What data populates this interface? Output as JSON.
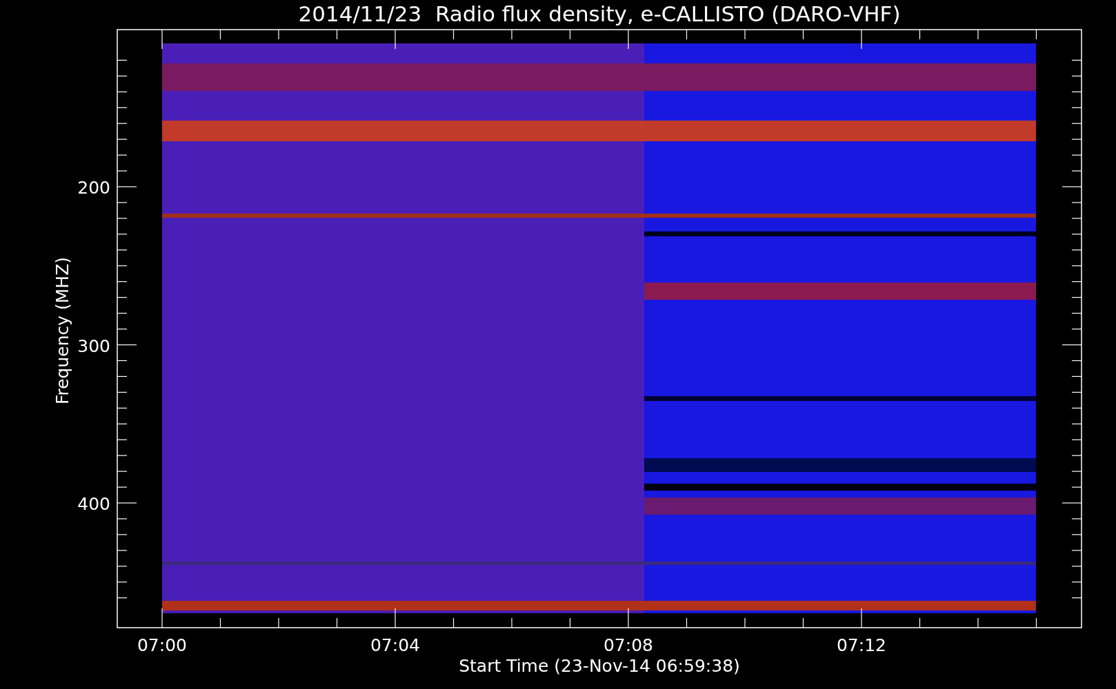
{
  "title": "2014/11/23  Radio flux density, e-CALLISTO (DARO-VHF)",
  "plot": {
    "ylabel": "Frequency (MHZ)",
    "xlabel": "Start Time (23-Nov-14 06:59:38)",
    "yticks": [
      "200",
      "300",
      "400"
    ],
    "xticks": [
      "07:00",
      "07:04",
      "07:08",
      "07:12"
    ]
  }
}
